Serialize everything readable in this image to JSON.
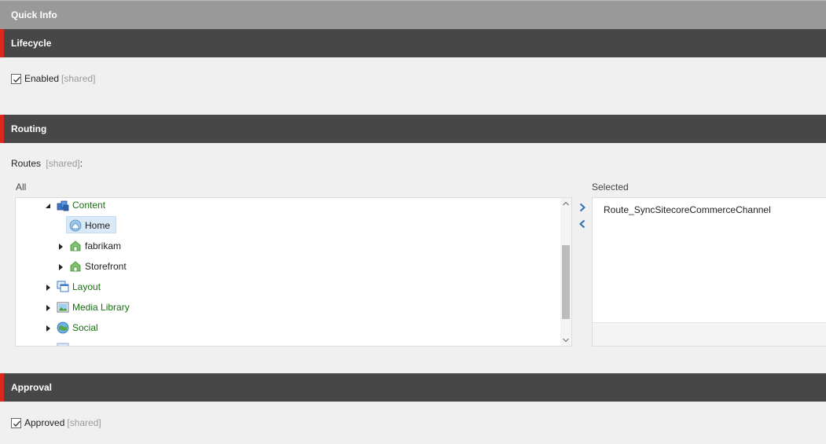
{
  "quick_info": {
    "title": "Quick Info"
  },
  "lifecycle": {
    "title": "Lifecycle",
    "enabled": {
      "label": "Enabled",
      "tag": "[shared]",
      "checked": true
    }
  },
  "routing": {
    "title": "Routing",
    "routes_label": "Routes",
    "routes_tag": "[shared]",
    "routes_suffix": ":",
    "all_label": "All",
    "selected_label": "Selected",
    "tree": [
      {
        "label": "Content",
        "icon": "content-icon",
        "expanded": true
      },
      {
        "label": "Home",
        "icon": "home-icon",
        "selected": true
      },
      {
        "label": "fabrikam",
        "icon": "site-icon",
        "expanded": false
      },
      {
        "label": "Storefront",
        "icon": "site-icon",
        "expanded": false
      },
      {
        "label": "Layout",
        "icon": "layout-icon",
        "expanded": false
      },
      {
        "label": "Media Library",
        "icon": "media-library-icon",
        "expanded": false
      },
      {
        "label": "Social",
        "icon": "social-icon",
        "expanded": false
      }
    ],
    "selected_items": [
      "Route_SyncSitecoreCommerceChannel"
    ]
  },
  "approval": {
    "title": "Approval",
    "approved": {
      "label": "Approved",
      "tag": "[shared]",
      "checked": true
    }
  },
  "colors": {
    "header_dark": "#474747",
    "header_light": "#999999",
    "accent_red": "#dc291e",
    "tree_text_green": "#16700f",
    "arrow_blue": "#2f6fb4"
  }
}
